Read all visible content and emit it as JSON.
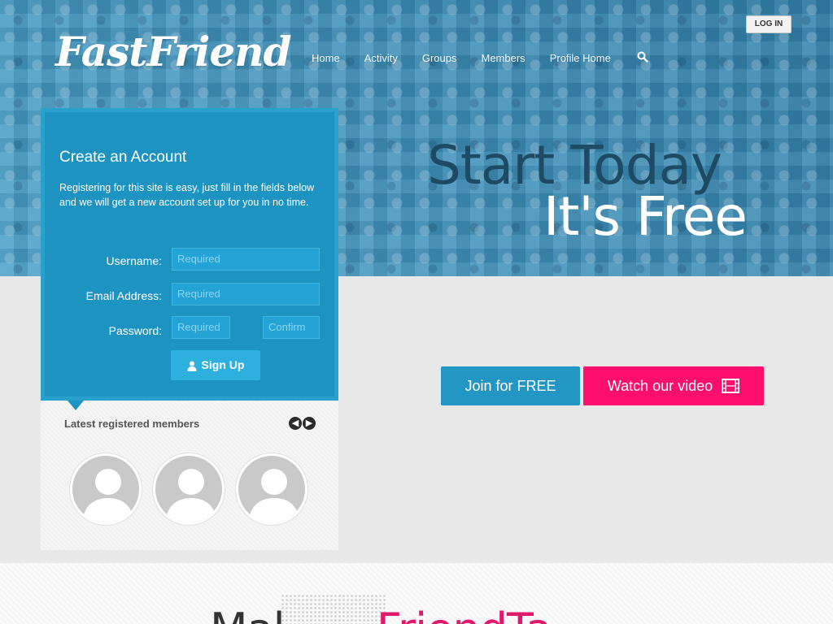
{
  "header": {
    "logo_text": "FastFriend",
    "nav": [
      "Home",
      "Activity",
      "Groups",
      "Members",
      "Profile Home"
    ],
    "login_label": "LOG IN"
  },
  "hero": {
    "line1": "Start Today",
    "line2": "It's Free"
  },
  "register": {
    "title": "Create an Account",
    "description": "Registering for this site is easy, just fill in the fields below and we will get a new account set up for you in no time.",
    "username_label": "Username:",
    "email_label": "Email Address:",
    "password_label": "Password:",
    "placeholder_required": "Required",
    "placeholder_confirm": "Confirm",
    "signup_label": "Sign Up"
  },
  "members": {
    "title": "Latest registered members",
    "prev": "◀",
    "next": "▶"
  },
  "cta": {
    "join_label": "Join for FREE",
    "video_label": "Watch our video"
  },
  "bottom": {
    "heading_part1": "Mal",
    "heading_part2": "FriendTa",
    "heading_gap": "       "
  },
  "colors": {
    "brand_blue": "#1d93c1",
    "accent_pink": "#ff0f6d"
  }
}
